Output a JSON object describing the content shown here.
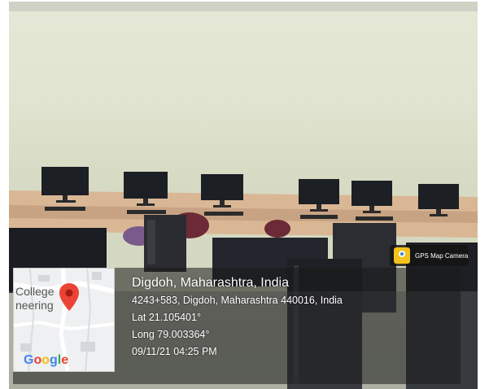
{
  "stamp": {
    "app_label": "GPS Map Camera",
    "map": {
      "label_line1": "College",
      "label_line2": "neering",
      "provider": "Google",
      "icon": "map-pin-icon"
    },
    "place": "Digdoh, Maharashtra, India",
    "address": "4243+583, Digdoh, Maharashtra 440016, India",
    "latitude": "Lat 21.105401°",
    "longitude": "Long 79.003364°",
    "datetime": "09/11/21 04:25 PM"
  },
  "colors": {
    "wall": "#e1e4d0",
    "desk": "#d9b795",
    "panel": "#1e1e1e",
    "google_blue": "#4285F4",
    "google_red": "#EA4335",
    "google_yellow": "#FBBC05",
    "google_green": "#34A853"
  }
}
